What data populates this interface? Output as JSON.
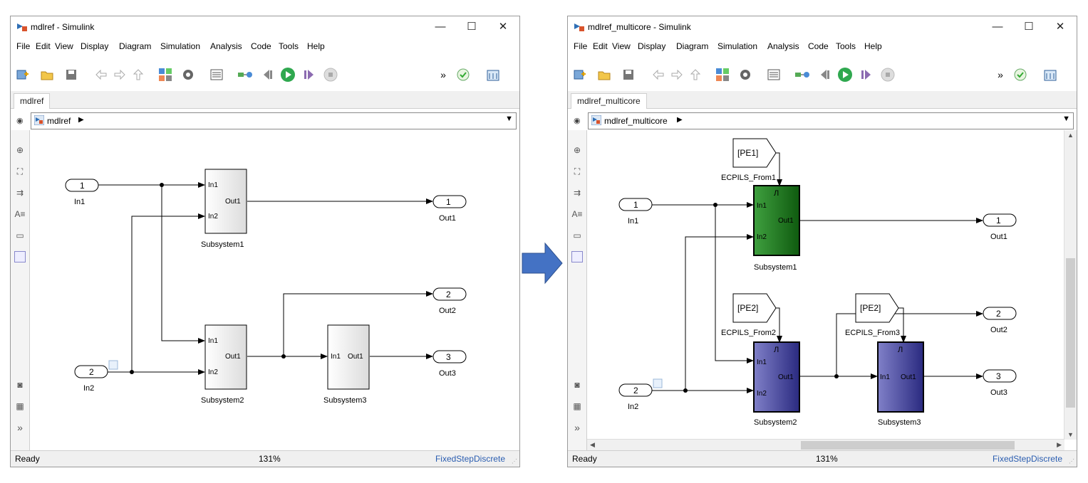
{
  "left": {
    "title": "mdlref - Simulink",
    "tab": "mdlref",
    "address": "mdlref",
    "status": {
      "ready": "Ready",
      "zoom": "131%",
      "solver": "FixedStepDiscrete"
    },
    "blocks": {
      "in1_port": "1",
      "in1_name": "In1",
      "in2_port": "2",
      "in2_name": "In2",
      "out1_port": "1",
      "out1_name": "Out1",
      "out2_port": "2",
      "out2_name": "Out2",
      "out3_port": "3",
      "out3_name": "Out3",
      "sub1_name": "Subsystem1",
      "sub2_name": "Subsystem2",
      "sub3_name": "Subsystem3",
      "port_in1": "In1",
      "port_in2": "In2",
      "port_out1": "Out1"
    }
  },
  "right": {
    "title": "mdlref_multicore - Simulink",
    "tab": "mdlref_multicore",
    "address": "mdlref_multicore",
    "status": {
      "ready": "Ready",
      "zoom": "131%",
      "solver": "FixedStepDiscrete"
    },
    "blocks": {
      "in1_port": "1",
      "in1_name": "In1",
      "in2_port": "2",
      "in2_name": "In2",
      "out1_port": "1",
      "out1_name": "Out1",
      "out2_port": "2",
      "out2_name": "Out2",
      "out3_port": "3",
      "out3_name": "Out3",
      "sub1_name": "Subsystem1",
      "sub2_name": "Subsystem2",
      "sub3_name": "Subsystem3",
      "port_in1": "In1",
      "port_in2": "In2",
      "port_out1": "Out1",
      "from1_tag": "[PE1]",
      "from1_name": "ECPILS_From1",
      "from2_tag": "[PE2]",
      "from2_name": "ECPILS_From2",
      "from3_tag": "[PE2]",
      "from3_name": "ECPILS_From3",
      "trigger": "Л"
    }
  },
  "menu": {
    "file": "File",
    "edit": "Edit",
    "view": "View",
    "display": "Display",
    "diagram": "Diagram",
    "simulation": "Simulation",
    "analysis": "Analysis",
    "code": "Code",
    "tools": "Tools",
    "help": "Help"
  },
  "window_controls": {
    "minimize": "—",
    "maximize": "☐",
    "close": "✕"
  },
  "toolbar_glyphs": {
    "more": "»"
  },
  "palette_glyphs": {
    "expand": "»"
  },
  "colors": {
    "green_block": "#1f7a1f",
    "blue_block": "#4a4aa6",
    "arrow": "#4472c4"
  },
  "icons": [
    "simulink-model-icon",
    "new-model-icon",
    "open-folder-icon",
    "save-icon",
    "back-icon",
    "forward-icon",
    "up-icon",
    "library-browser-icon",
    "settings-gear-icon",
    "model-explorer-icon",
    "update-diagram-icon",
    "step-back-icon",
    "run-icon",
    "step-forward-icon",
    "stop-icon",
    "check-icon",
    "data-inspector-icon"
  ]
}
